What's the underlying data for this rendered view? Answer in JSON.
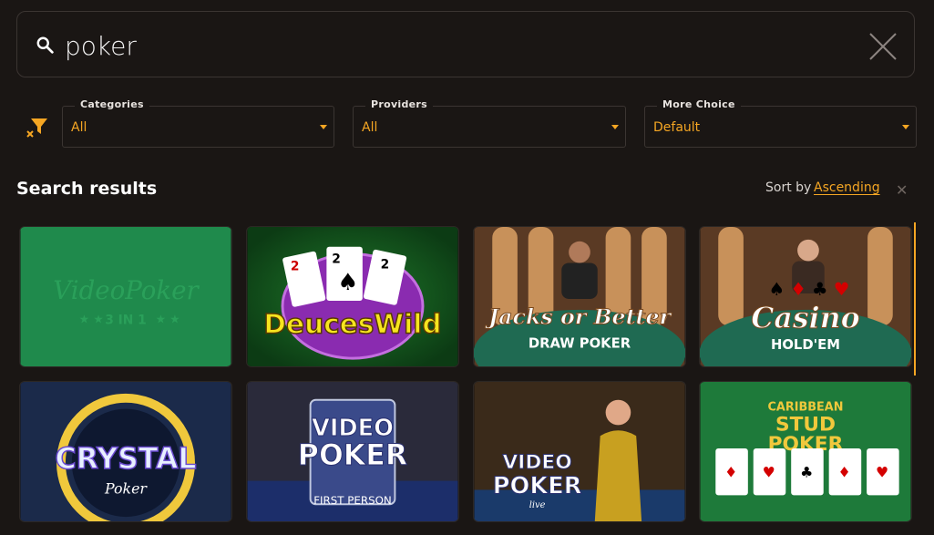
{
  "search": {
    "value": "poker"
  },
  "filters": [
    {
      "label": "Categories",
      "value": "All"
    },
    {
      "label": "Providers",
      "value": "All"
    },
    {
      "label": "More Choice",
      "value": "Default"
    }
  ],
  "results": {
    "title": "Search results",
    "sort_label": "Sort by",
    "sort_value": "Ascending",
    "sort_clear": "✕"
  },
  "games": [
    {
      "logo_lines": [
        "VideoPoker",
        "3 IN 1"
      ]
    },
    {
      "logo_lines": [
        "DeucesWild"
      ]
    },
    {
      "logo_lines": [
        "Jacks or Better",
        "DRAW POKER"
      ]
    },
    {
      "logo_lines": [
        "Casino",
        "HOLD'EM"
      ]
    },
    {
      "logo_lines": [
        "CRYSTAL",
        "Poker"
      ]
    },
    {
      "logo_lines": [
        "VIDEO",
        "POKER",
        "FIRST PERSON"
      ]
    },
    {
      "logo_lines": [
        "VIDEO",
        "POKER",
        "live"
      ]
    },
    {
      "logo_lines": [
        "CARIBBEAN",
        "STUD",
        "POKER"
      ]
    }
  ],
  "colors": {
    "accent": "#f5a623",
    "background": "#1a1614",
    "border": "#3b3532"
  }
}
